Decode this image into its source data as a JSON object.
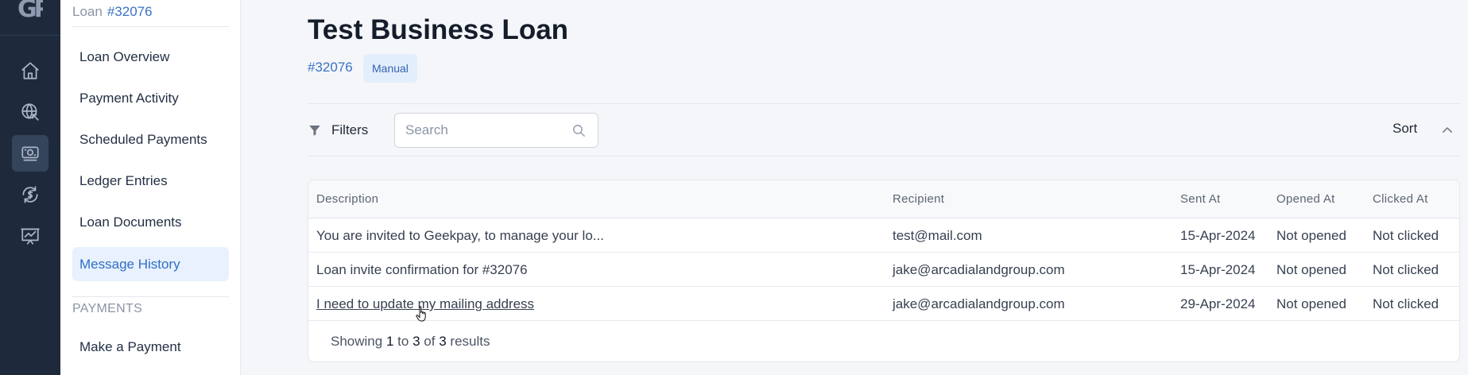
{
  "rail": {
    "logo": "GP",
    "items": [
      {
        "icon": "home-icon"
      },
      {
        "icon": "globe-icon"
      },
      {
        "icon": "cash-icon",
        "active": true
      },
      {
        "icon": "dollar-cycle-icon"
      },
      {
        "icon": "chart-board-icon"
      }
    ]
  },
  "subnav": {
    "crumb_label": "Loan",
    "crumb_number": "#32076",
    "items": [
      {
        "label": "Loan Overview"
      },
      {
        "label": "Payment Activity"
      },
      {
        "label": "Scheduled Payments"
      },
      {
        "label": "Ledger Entries"
      },
      {
        "label": "Loan Documents"
      },
      {
        "label": "Message History",
        "active": true
      }
    ],
    "section_label": "PAYMENTS",
    "section_items": [
      {
        "label": "Make a Payment"
      }
    ]
  },
  "header": {
    "title": "Test Business Loan",
    "loan_id": "#32076",
    "badge": "Manual"
  },
  "toolbar": {
    "filters_label": "Filters",
    "search_placeholder": "Search",
    "sort_label": "Sort"
  },
  "table": {
    "columns": [
      "Description",
      "Recipient",
      "Sent At",
      "Opened At",
      "Clicked At"
    ],
    "rows": [
      [
        "You are invited to Geekpay, to manage your lo...",
        "test@mail.com",
        "15-Apr-2024",
        "Not opened",
        "Not clicked"
      ],
      [
        "Loan invite confirmation for #32076",
        "jake@arcadialandgroup.com",
        "15-Apr-2024",
        "Not opened",
        "Not clicked"
      ],
      [
        "I need to update my mailing address",
        "jake@arcadialandgroup.com",
        "29-Apr-2024",
        "Not opened",
        "Not clicked"
      ]
    ],
    "footer": {
      "prefix": "Showing",
      "from": "1",
      "to_word": "to",
      "to": "3",
      "of_word": "of",
      "total": "3",
      "suffix": "results"
    }
  },
  "colors": {
    "rail_bg": "#1e2a3b",
    "accent": "#3b73c5",
    "active_nav_bg": "#e8f1fd"
  }
}
